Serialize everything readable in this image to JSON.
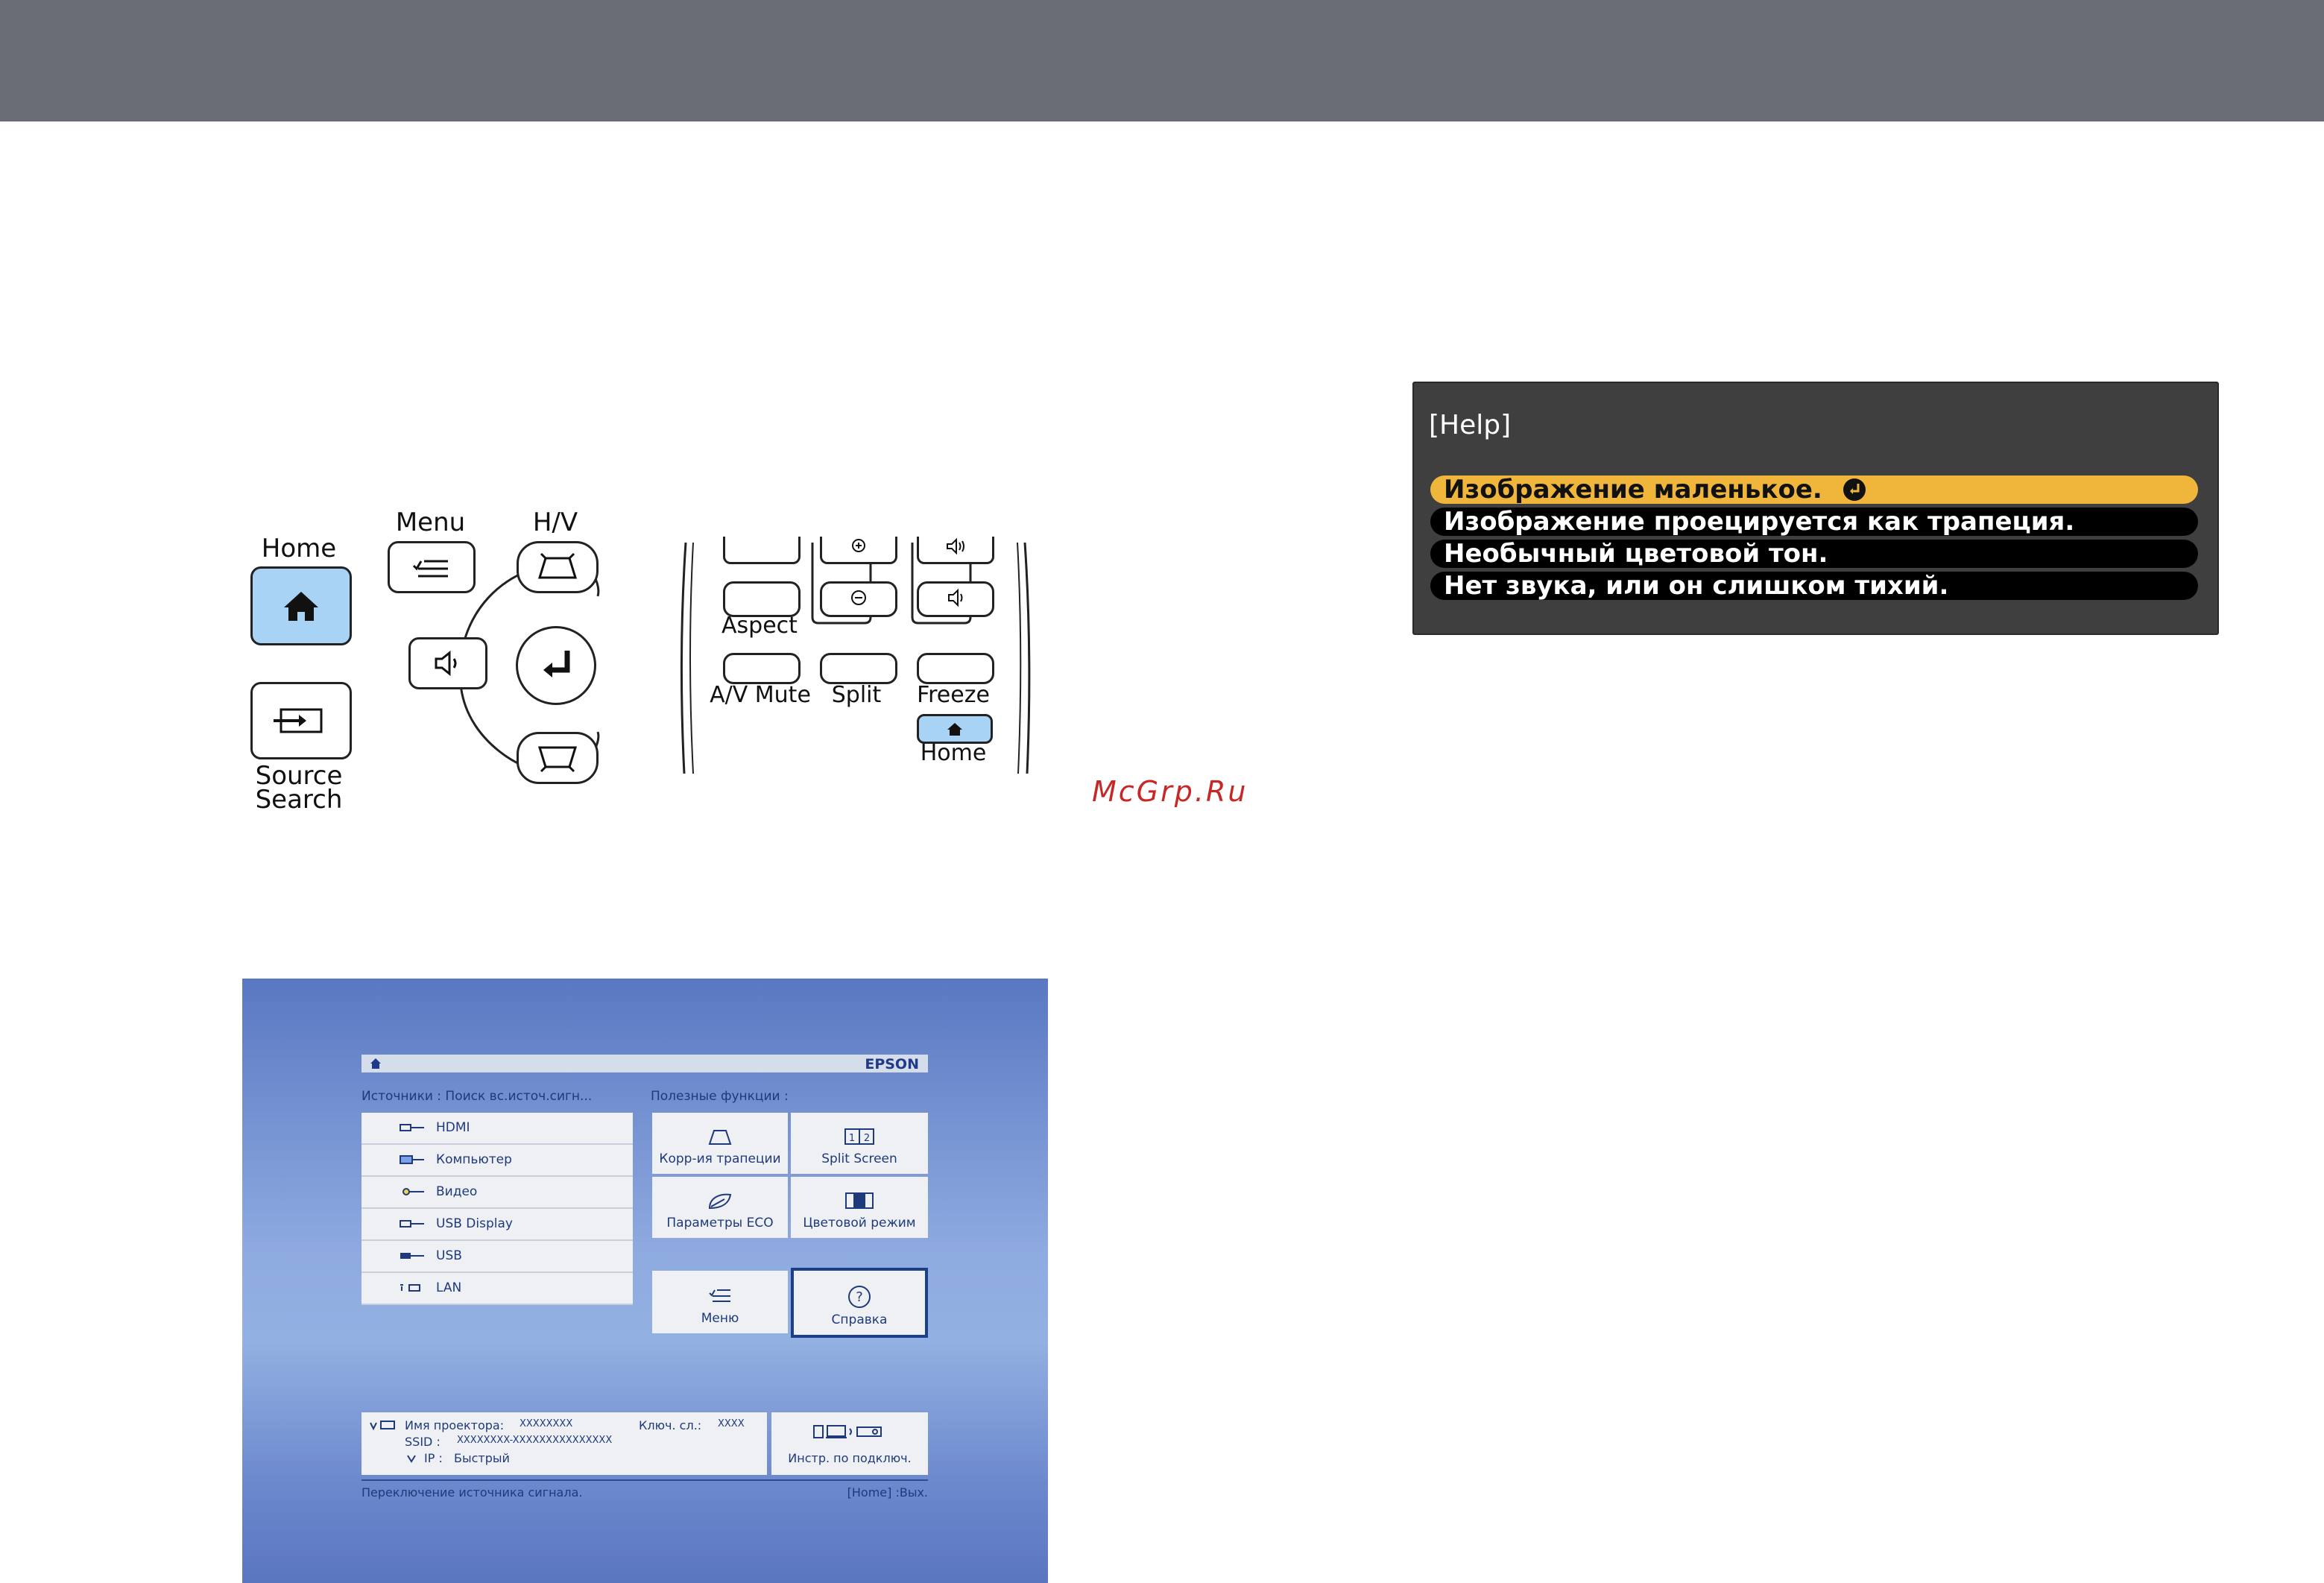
{
  "remote_panel": {
    "home_label": "Home",
    "menu_label": "Menu",
    "hv_label": "H/V",
    "source_search_line1": "Source",
    "source_search_line2": "Search",
    "aspect_label": "Aspect",
    "av_mute_label": "A/V Mute",
    "split_label": "Split",
    "freeze_label": "Freeze",
    "home2_label": "Home"
  },
  "watermark": "McGrp.Ru",
  "help_window": {
    "title": "[Help]",
    "items": [
      "Изображение маленькое.",
      "Изображение проецируется как трапеция.",
      "Необычный цветовой тон.",
      "Нет звука, или он слишком тихий."
    ],
    "selected_index": 0,
    "colors": {
      "background": "#3f3f3f",
      "selected": "#f0b63c"
    }
  },
  "home_screen": {
    "brand": "EPSON",
    "sources_heading": "Источники :  Поиск вс.источ.сигн...",
    "functions_heading": "Полезные функции :",
    "sources": [
      "HDMI",
      "Компьютер",
      "Видео",
      "USB Display",
      "USB",
      "LAN"
    ],
    "tiles": {
      "keystone": "Корр-ия трапеции",
      "split_screen": "Split Screen",
      "eco": "Параметры ECO",
      "color_mode": "Цветовой режим",
      "menu": "Меню",
      "help": "Справка"
    },
    "info": {
      "projector_name_label": "Имя проектора:",
      "projector_name_value": "XXXXXXXX",
      "key_label": "Ключ. сл.:",
      "key_value": "XXXX",
      "ssid_label": "SSID :",
      "ssid_value": "XXXXXXXX-XXXXXXXXXXXXXXX",
      "ip_label": "IP :",
      "ip_value": "Быстрый"
    },
    "connection_guide": "Инстр. по подключ.",
    "hint_left": "Переключение источника сигнала.",
    "hint_right": "[Home] :Вых."
  }
}
